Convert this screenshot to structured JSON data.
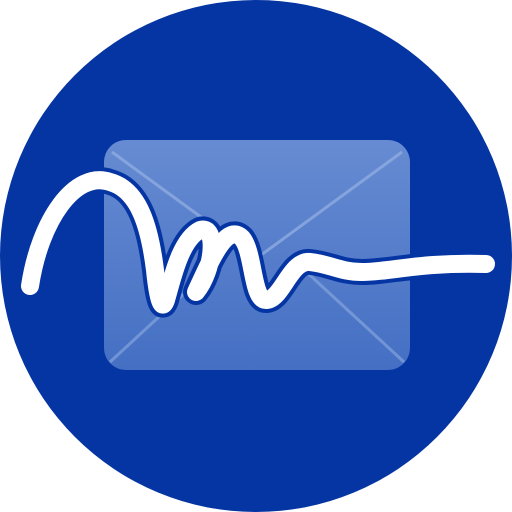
{
  "logo": {
    "name": "mail-signature-app-icon",
    "colors": {
      "background": "#ffffff",
      "circle": "#0535a3",
      "envelope_fill": "#4a74c6",
      "envelope_highlight": "#6f93d6",
      "envelope_edges": "#3a63b5",
      "stroke_outline": "#0535a3",
      "signature_stroke": "#ffffff"
    },
    "icons": [
      "envelope-icon",
      "signature-stroke-icon"
    ]
  }
}
